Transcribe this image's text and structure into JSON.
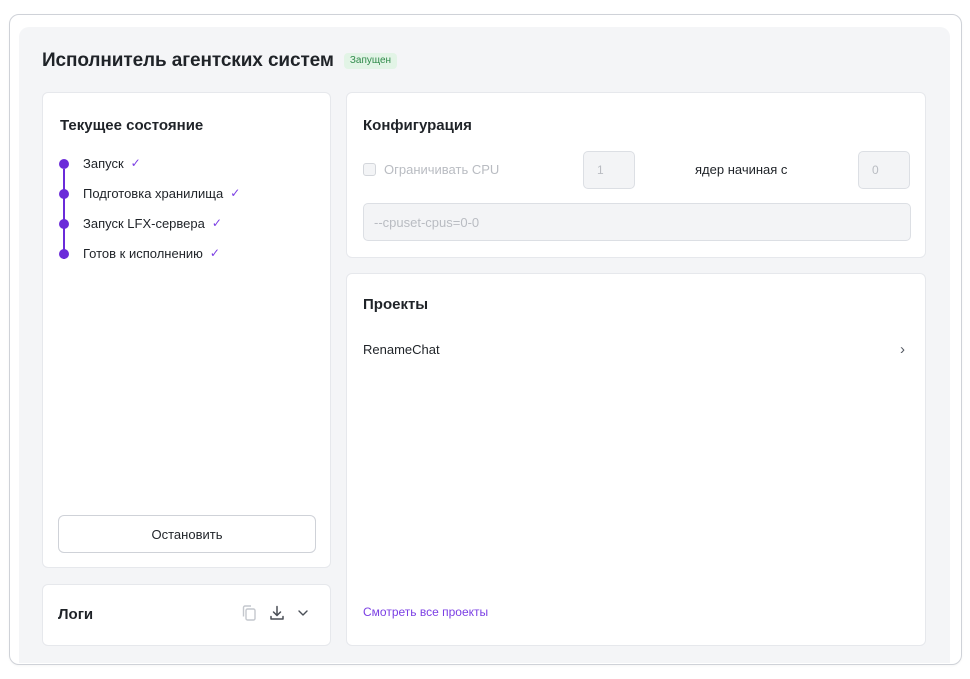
{
  "header": {
    "title": "Исполнитель агентских систем",
    "status_badge": "Запущен"
  },
  "state": {
    "title": "Текущее состояние",
    "steps": [
      {
        "label": "Запуск",
        "done": true
      },
      {
        "label": "Подготовка хранилища",
        "done": true
      },
      {
        "label": "Запуск LFX-сервера",
        "done": true
      },
      {
        "label": "Готов к исполнению",
        "done": true
      }
    ],
    "check_mark": "✓",
    "stop_button": "Остановить"
  },
  "logs": {
    "title": "Логи",
    "icons": [
      "copy-icon",
      "download-icon",
      "chevron-down-icon"
    ]
  },
  "config": {
    "title": "Конфигурация",
    "limit_cpu_label": "Ограничивать CPU",
    "limit_cpu_checked": false,
    "cpu_count_value": "1",
    "cores_from_label": "ядер начиная с",
    "start_core_value": "0",
    "cpuset_value": "--cpuset-cpus=0-0"
  },
  "projects": {
    "title": "Проекты",
    "items": [
      {
        "name": "RenameChat"
      }
    ],
    "view_all_link": "Смотреть все проекты"
  },
  "colors": {
    "accent": "#6b2bd9",
    "badge_text": "#2f8a4a",
    "badge_bg": "#e2f4e6",
    "link": "#7b3fe4"
  }
}
